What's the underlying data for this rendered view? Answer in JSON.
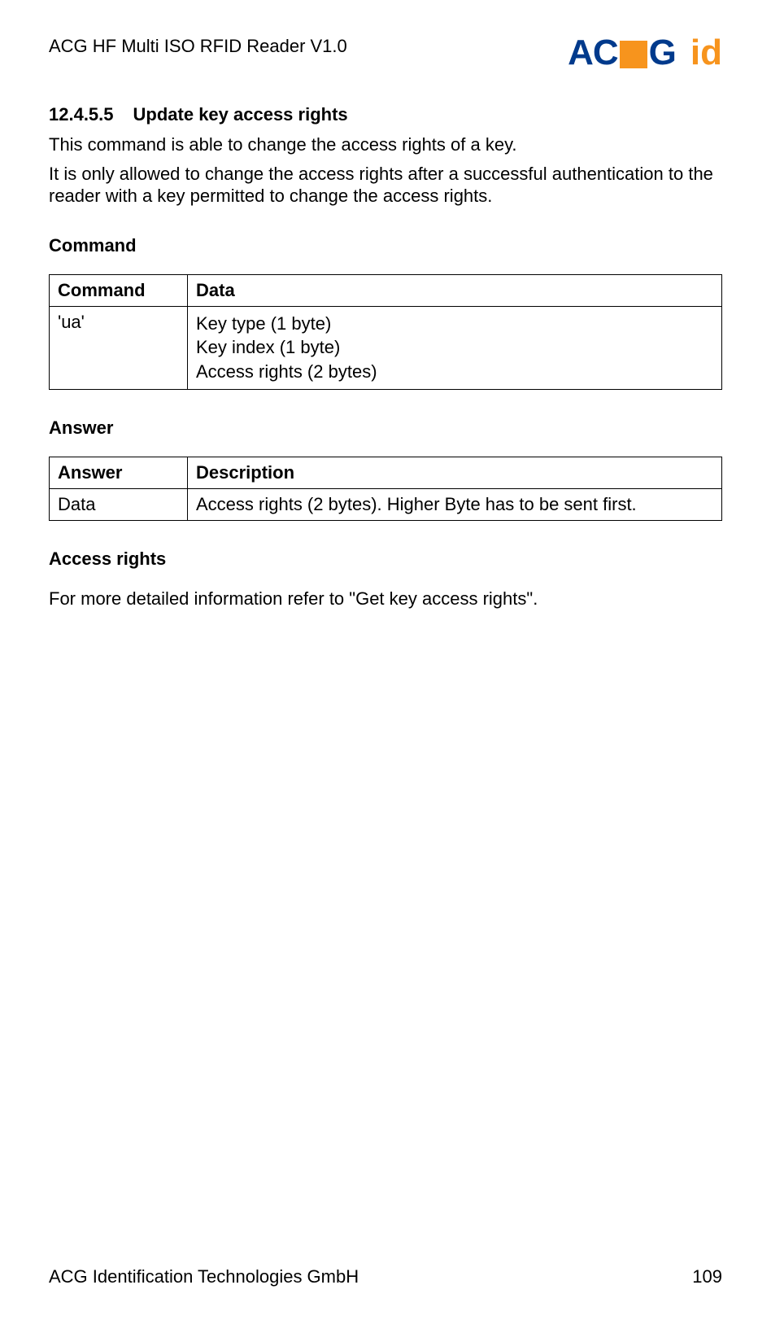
{
  "header": {
    "doc_title": "ACG HF Multi ISO RFID Reader V1.0",
    "logo_text_1": "AC",
    "logo_text_2": "G",
    "logo_text_3": "id"
  },
  "section": {
    "number": "12.4.5.5",
    "title": "Update key access rights",
    "para1": "This command is able to change the access rights of a key.",
    "para2": "It is only allowed to change the access rights after a successful authentication to the reader with a key permitted to change the access rights."
  },
  "command_block": {
    "heading": "Command",
    "th1": "Command",
    "th2": "Data",
    "row_cmd": "'ua'",
    "row_data_l1": "Key type (1 byte)",
    "row_data_l2": "Key index (1 byte)",
    "row_data_l3": "Access rights (2 bytes)"
  },
  "answer_block": {
    "heading": "Answer",
    "th1": "Answer",
    "th2": "Description",
    "row_ans": "Data",
    "row_desc": "Access rights (2 bytes). Higher Byte has to be sent first."
  },
  "access_block": {
    "heading": "Access rights",
    "para": "For more detailed information refer to \"Get key access rights\"."
  },
  "footer": {
    "left": "ACG Identification Technologies GmbH",
    "right": "109"
  }
}
